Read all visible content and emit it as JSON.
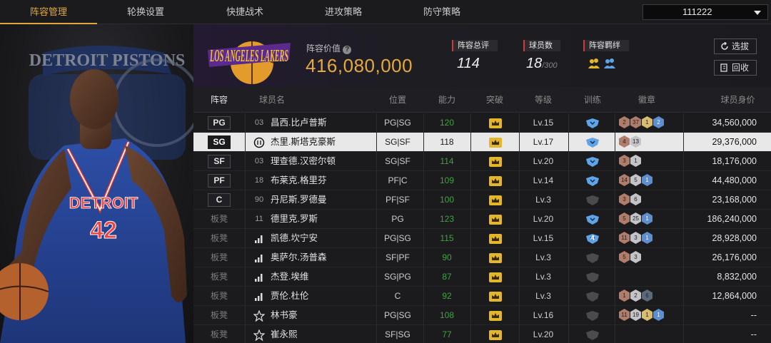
{
  "nav": {
    "tabs": [
      "阵容管理",
      "轮换设置",
      "快捷战术",
      "进攻策略",
      "防守策略"
    ],
    "active": 0,
    "team_selector": "111222"
  },
  "player_card": {
    "jersey_team": "DETROIT",
    "jersey_number": "42",
    "logo_text": "DETROIT PISTONS"
  },
  "header": {
    "team_logo_text": "LOS ANGELES LAKERS",
    "value_label": "阵容价值",
    "value": "416,080,000",
    "overall_label": "阵容总评",
    "overall": "114",
    "players_label": "球员数",
    "players_count": "18",
    "players_max": "/300",
    "chemistry_label": "阵容羁绊",
    "select_btn": "选拔",
    "recycle_btn": "回收"
  },
  "columns": [
    "阵容",
    "球员名",
    "位置",
    "能力",
    "突破",
    "等级",
    "训练",
    "徽章",
    "球员身价"
  ],
  "rows": [
    {
      "slot": "PG",
      "bench": false,
      "num": "03",
      "num_icon": "",
      "name": "昌西.比卢普斯",
      "pos": "PG|SG",
      "ability": "120",
      "ab_color": "#3fa23f",
      "level": "Lv.15",
      "train": "blue",
      "train_n": "",
      "badges": [
        [
          "bronze",
          "2"
        ],
        [
          "bronze",
          "37"
        ],
        [
          "gold",
          "1"
        ],
        [
          "blue",
          "2"
        ]
      ],
      "salary": "34,560,000"
    },
    {
      "slot": "SG",
      "bench": false,
      "num": "",
      "num_icon": "circle",
      "name": "杰里.斯塔克豪斯",
      "pos": "SG|SF",
      "ability": "118",
      "ab_color": "#111111",
      "level": "Lv.17",
      "train": "blue",
      "train_n": "",
      "badges": [
        [
          "bronze",
          "4"
        ],
        [
          "silver",
          "13"
        ]
      ],
      "salary": "29,376,000",
      "selected": true
    },
    {
      "slot": "SF",
      "bench": false,
      "num": "03",
      "num_icon": "",
      "name": "理查德.汉密尔顿",
      "pos": "SG|SF",
      "ability": "114",
      "ab_color": "#3fa23f",
      "level": "Lv.20",
      "train": "blue",
      "train_n": "",
      "badges": [
        [
          "bronze",
          "3"
        ],
        [
          "silver",
          "1"
        ]
      ],
      "salary": "18,176,000"
    },
    {
      "slot": "PF",
      "bench": false,
      "num": "18",
      "num_icon": "",
      "name": "布莱克.格里芬",
      "pos": "PF|C",
      "ability": "109",
      "ab_color": "#3fa23f",
      "level": "Lv.14",
      "train": "blue",
      "train_n": "",
      "badges": [
        [
          "bronze",
          "14"
        ],
        [
          "silver",
          "5"
        ],
        [
          "blue",
          "1"
        ]
      ],
      "salary": "44,480,000"
    },
    {
      "slot": "C",
      "bench": false,
      "num": "90",
      "num_icon": "",
      "name": "丹尼斯.罗德曼",
      "pos": "PF|SF",
      "ability": "100",
      "ab_color": "#3fa23f",
      "level": "Lv.3",
      "train": "gray",
      "train_n": "",
      "badges": [
        [
          "bronze",
          "3"
        ],
        [
          "silver",
          "6"
        ]
      ],
      "salary": "23,168,000"
    },
    {
      "slot": "板凳",
      "bench": true,
      "num": "11",
      "num_icon": "",
      "name": "德里克.罗斯",
      "pos": "PG",
      "ability": "123",
      "ab_color": "#3fa23f",
      "level": "Lv.20",
      "train": "blue",
      "train_n": "",
      "badges": [
        [
          "bronze",
          "5"
        ],
        [
          "silver",
          "25"
        ],
        [
          "blue",
          "1"
        ]
      ],
      "salary": "186,240,000"
    },
    {
      "slot": "板凳",
      "bench": true,
      "num": "",
      "num_icon": "bars",
      "name": "凯德.坎宁安",
      "pos": "PG|SG",
      "ability": "115",
      "ab_color": "#3fa23f",
      "level": "Lv.15",
      "train": "blue",
      "train_n": "4",
      "badges": [
        [
          "bronze",
          "11"
        ],
        [
          "silver",
          "3"
        ],
        [
          "blue",
          "1"
        ]
      ],
      "salary": "28,928,000"
    },
    {
      "slot": "板凳",
      "bench": true,
      "num": "",
      "num_icon": "bars",
      "name": "奥萨尔.汤普森",
      "pos": "SF|PF",
      "ability": "90",
      "ab_color": "#3fa23f",
      "level": "Lv.3",
      "train": "gray",
      "train_n": "",
      "badges": [
        [
          "bronze",
          "5"
        ],
        [
          "silver",
          "3"
        ]
      ],
      "salary": "26,176,000"
    },
    {
      "slot": "板凳",
      "bench": true,
      "num": "",
      "num_icon": "bars",
      "name": "杰登.埃维",
      "pos": "SG|PG",
      "ability": "87",
      "ab_color": "#3fa23f",
      "level": "Lv.3",
      "train": "gray",
      "train_n": "",
      "badges": [],
      "salary": "8,832,000"
    },
    {
      "slot": "板凳",
      "bench": true,
      "num": "",
      "num_icon": "bars",
      "name": "贾伦.杜伦",
      "pos": "C",
      "ability": "92",
      "ab_color": "#3fa23f",
      "level": "Lv.3",
      "train": "gray",
      "train_n": "",
      "badges": [
        [
          "bronze",
          "1"
        ],
        [
          "silver",
          "2"
        ],
        [
          "dark",
          "6"
        ]
      ],
      "salary": "12,864,000"
    },
    {
      "slot": "板凳",
      "bench": true,
      "num": "",
      "num_icon": "star",
      "name": "林书豪",
      "pos": "PG|SG",
      "ability": "108",
      "ab_color": "#3fa23f",
      "level": "Lv.16",
      "train": "gray",
      "train_n": "",
      "badges": [
        [
          "bronze",
          "11"
        ],
        [
          "silver",
          "19"
        ],
        [
          "gold",
          "1"
        ],
        [
          "blue",
          "1"
        ]
      ],
      "salary": "--"
    },
    {
      "slot": "板凳",
      "bench": true,
      "num": "",
      "num_icon": "star",
      "name": "崔永熙",
      "pos": "SF|SG",
      "ability": "77",
      "ab_color": "#3fa23f",
      "level": "Lv.20",
      "train": "gray",
      "train_n": "",
      "badges": [],
      "salary": "--"
    }
  ]
}
